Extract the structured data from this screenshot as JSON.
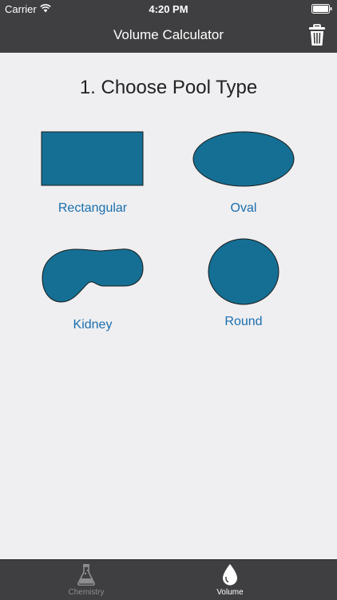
{
  "status_bar": {
    "carrier": "Carrier",
    "time": "4:20 PM"
  },
  "nav": {
    "title": "Volume Calculator"
  },
  "main": {
    "heading": "1. Choose Pool Type",
    "pool_types": [
      {
        "label": "Rectangular",
        "icon": "rectangle-pool-icon"
      },
      {
        "label": "Oval",
        "icon": "oval-pool-icon"
      },
      {
        "label": "Kidney",
        "icon": "kidney-pool-icon"
      },
      {
        "label": "Round",
        "icon": "round-pool-icon"
      }
    ]
  },
  "tabs": [
    {
      "label": "Chemistry",
      "icon": "flask-icon",
      "active": false
    },
    {
      "label": "Volume",
      "icon": "water-drop-icon",
      "active": true
    }
  ],
  "colors": {
    "bar_background": "#3f3f41",
    "page_background": "#efeff1",
    "pool_fill": "#156f94",
    "link": "#1a6fae"
  }
}
